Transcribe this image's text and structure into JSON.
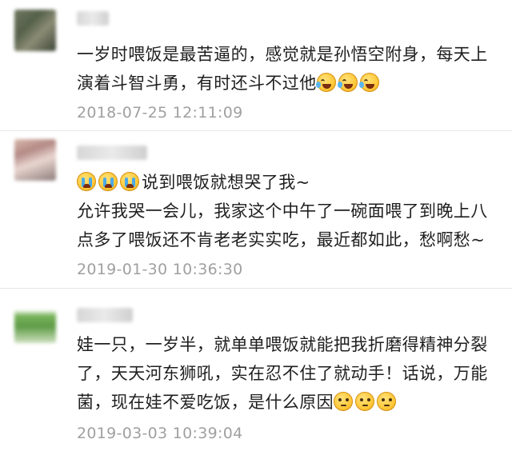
{
  "comments": [
    {
      "text_line1": "一岁时喂饭是最苦逼的，感觉就是孙悟空附身，每天上",
      "text_line2": "演着斗智斗勇，有时还斗不过他",
      "emoji": "laugh-cry-icon",
      "timestamp": "2018-07-25 12:11:09"
    },
    {
      "text_line1": "说到喂饭就想哭了我~",
      "text_line2": "允许我哭一会儿，我家这个中午了一碗面喂了到晚上八",
      "text_line3": "点多了喂饭还不肯老老实实吃，最近都如此，愁啊愁~",
      "emoji": "crying-icon",
      "timestamp": "2019-01-30 10:36:30"
    },
    {
      "text_line1": "娃一只，一岁半，就单单喂饭就能把我折磨得精神分裂",
      "text_line2": "了，天天河东狮吼，实在忍不住了就动手！话说，万能",
      "text_line3": "菌，现在娃不爱吃饭，是什么原因",
      "emoji": "awkward-icon",
      "timestamp": "2019-03-03 10:39:04"
    }
  ],
  "colors": {
    "text": "#1f1f1f",
    "timestamp": "#a0a0a0",
    "divider": "#e6e6e6",
    "emoji": "#ffc93a"
  }
}
